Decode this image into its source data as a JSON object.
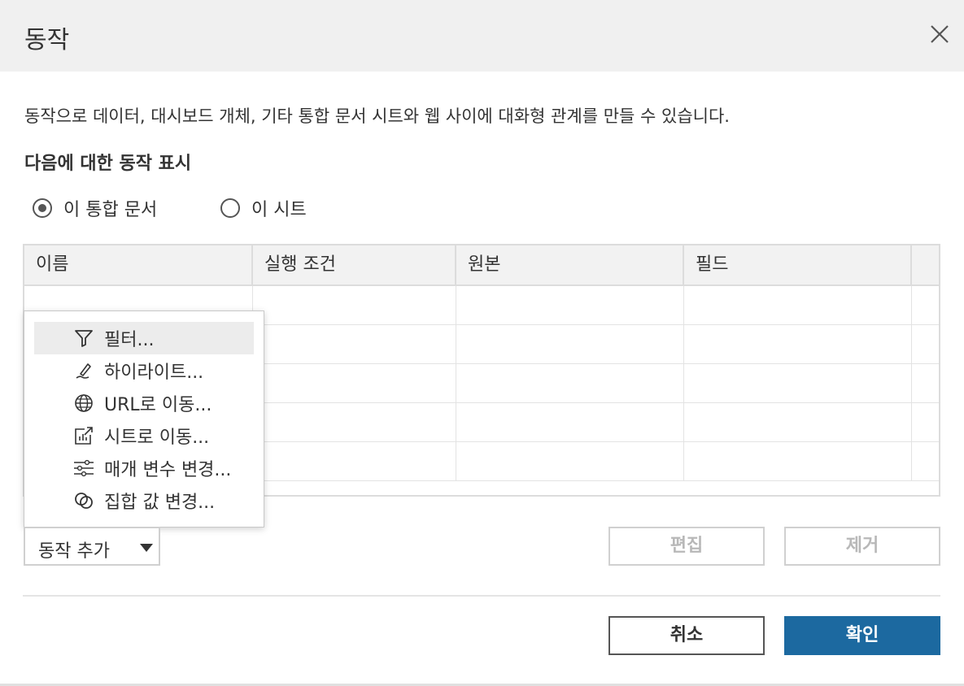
{
  "dialog": {
    "title": "동작",
    "description": "동작으로 데이터, 대시보드 개체, 기타 통합 문서 시트와 웹 사이에 대화형 관계를 만들 수 있습니다.",
    "section_label": "다음에 대한 동작 표시"
  },
  "scope": {
    "options": [
      {
        "label": "이 통합 문서",
        "selected": true
      },
      {
        "label": "이 시트",
        "selected": false
      }
    ]
  },
  "table": {
    "columns": [
      "이름",
      "실행 조건",
      "원본",
      "필드"
    ],
    "rows": []
  },
  "add_menu": {
    "items": [
      {
        "label": "필터...",
        "icon": "filter-icon"
      },
      {
        "label": "하이라이트...",
        "icon": "highlight-icon"
      },
      {
        "label": "URL로 이동...",
        "icon": "globe-icon"
      },
      {
        "label": "시트로 이동...",
        "icon": "sheet-link-icon"
      },
      {
        "label": "매개 변수 변경...",
        "icon": "sliders-icon"
      },
      {
        "label": "집합 값 변경...",
        "icon": "set-icon"
      }
    ]
  },
  "buttons": {
    "add_action": "동작 추가",
    "edit": "편집",
    "remove": "제거",
    "cancel": "취소",
    "ok": "확인"
  },
  "colors": {
    "accent": "#1c69a0",
    "header_bg": "#f0f0f0"
  }
}
